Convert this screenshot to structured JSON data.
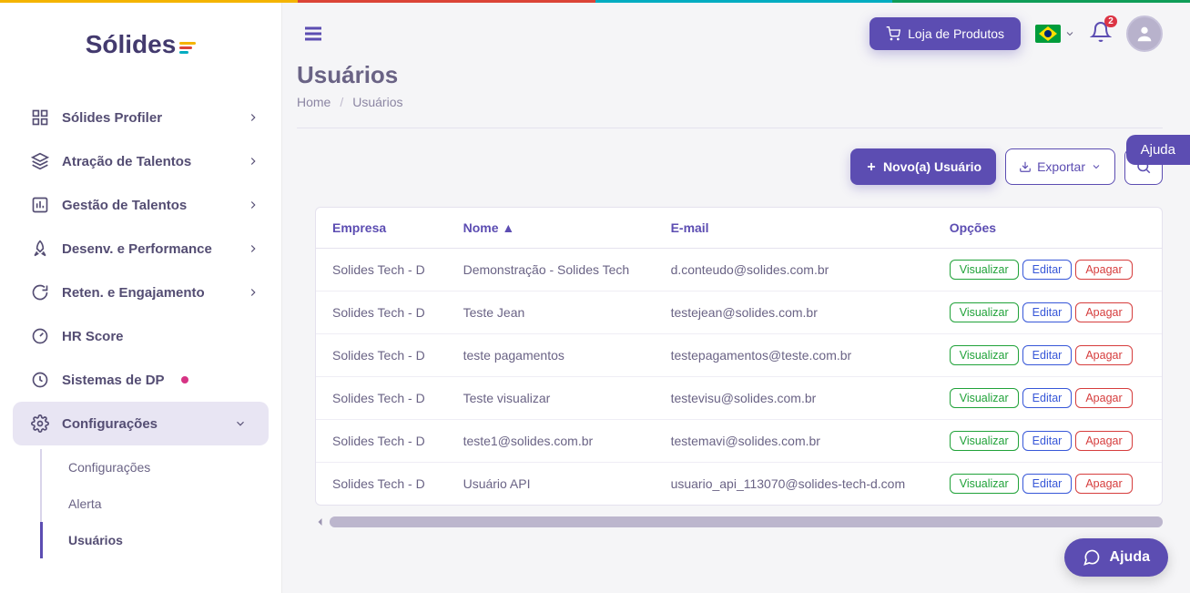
{
  "brand": {
    "name": "Sólides"
  },
  "header": {
    "shop_button": "Loja de Produtos",
    "notification_count": "2"
  },
  "sidebar": {
    "items": [
      {
        "label": "Sólides Profiler",
        "expandable": true
      },
      {
        "label": "Atração de Talentos",
        "expandable": true
      },
      {
        "label": "Gestão de Talentos",
        "expandable": true
      },
      {
        "label": "Desenv. e Performance",
        "expandable": true
      },
      {
        "label": "Reten. e Engajamento",
        "expandable": true
      },
      {
        "label": "HR Score",
        "expandable": false
      },
      {
        "label": "Sistemas de DP",
        "expandable": false,
        "dot": true
      },
      {
        "label": "Configurações",
        "expandable": true,
        "active": true
      }
    ],
    "submenu": {
      "items": [
        {
          "label": "Configurações"
        },
        {
          "label": "Alerta"
        },
        {
          "label": "Usuários",
          "active": true
        }
      ]
    }
  },
  "page": {
    "title": "Usuários",
    "breadcrumb_home": "Home",
    "breadcrumb_current": "Usuários"
  },
  "actions": {
    "new": "Novo(a) Usuário",
    "export": "Exportar"
  },
  "table": {
    "columns": {
      "company": "Empresa",
      "name": "Nome ▲",
      "email": "E-mail",
      "options": "Opções"
    },
    "option_labels": {
      "view": "Visualizar",
      "edit": "Editar",
      "delete": "Apagar"
    },
    "rows": [
      {
        "company": "Solides Tech - D",
        "name": "Demonstração - Solides Tech",
        "email": "d.conteudo@solides.com.br"
      },
      {
        "company": "Solides Tech - D",
        "name": "Teste Jean",
        "email": "testejean@solides.com.br"
      },
      {
        "company": "Solides Tech - D",
        "name": "teste pagamentos",
        "email": "testepagamentos@teste.com.br"
      },
      {
        "company": "Solides Tech - D",
        "name": "Teste visualizar",
        "email": "testevisu@solides.com.br"
      },
      {
        "company": "Solides Tech - D",
        "name": "teste1@solides.com.br",
        "email": "testemavi@solides.com.br"
      },
      {
        "company": "Solides Tech - D",
        "name": "Usuário API",
        "email": "usuario_api_113070@solides-tech-d.com"
      }
    ]
  },
  "help": {
    "tab": "Ajuda",
    "bubble": "Ajuda"
  }
}
